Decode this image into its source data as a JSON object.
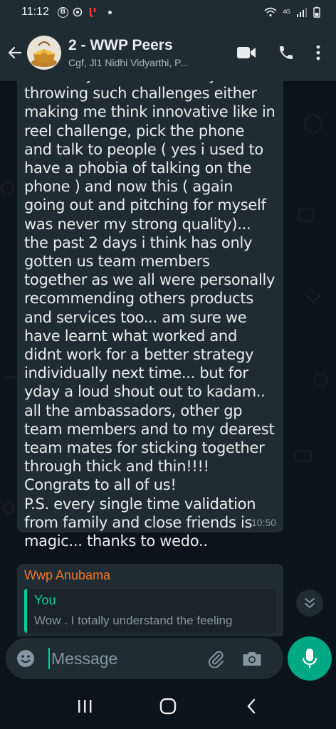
{
  "status_bar": {
    "time": "11:12",
    "b_badge": "B",
    "network": "4G"
  },
  "header": {
    "title": "2 - WWP Peers",
    "subtitle": "Cgf, Jl1 Nidhi Vidyarthi, P..."
  },
  "messages": [
    {
      "text": "out of my comfort zone by throwing such challenges either making me think innovative like in reel challenge, pick the phone and talk to people ( yes i used to have a phobia of talking on the phone ) and now this ( again going out and pitching for myself was never my strong quality)... the past 2 days i think has only gotten us team members together as we all were personally recommending others products and services too... am sure we have learnt what worked and didnt work for a better strategy individually next time... but for yday a loud shout out to kadam.. all the ambassadors, other gp team members and to my dearest team mates for sticking together through thick and thin!!!! Congrats to all of us!\nP.S. every single time validation from family and close friends is magic... thanks to wedo..",
      "time": "10:50"
    },
    {
      "sender": "Wwp Anubama",
      "quoted_author": "You",
      "quoted_text": "Wow . I totally understand the feeling"
    }
  ],
  "input": {
    "placeholder": "Message"
  },
  "colors": {
    "accent": "#00a884",
    "bubble": "#202c33",
    "header": "#1f2c33",
    "sender_name": "#f0762b",
    "quote_author": "#06cf9c"
  },
  "icons": [
    "back-arrow-icon",
    "video-call-icon",
    "phone-icon",
    "more-options-icon",
    "emoji-icon",
    "attach-icon",
    "camera-icon",
    "mic-icon",
    "chevron-down-icon",
    "recent-apps-icon",
    "home-icon",
    "back-nav-icon"
  ]
}
